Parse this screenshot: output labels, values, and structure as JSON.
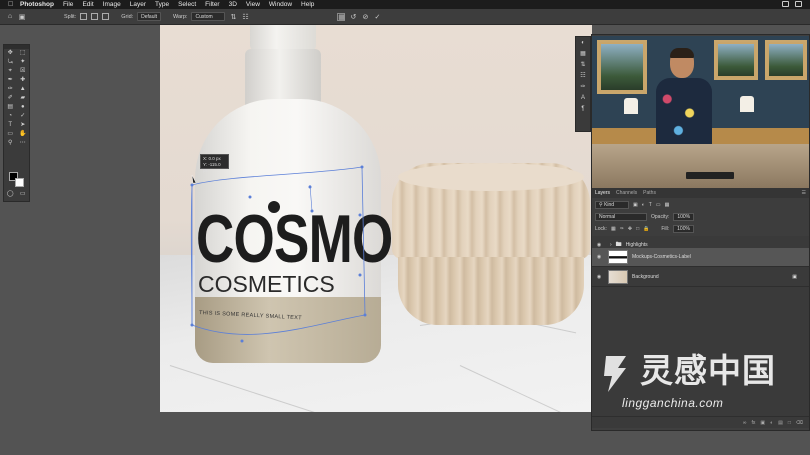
{
  "menubar": {
    "app": "Photoshop",
    "items": [
      "File",
      "Edit",
      "Image",
      "Layer",
      "Type",
      "Select",
      "Filter",
      "3D",
      "View",
      "Window",
      "Help"
    ]
  },
  "options": {
    "split_label": "Split:",
    "grid_label": "Grid:",
    "grid_value": "Default",
    "warp_label": "Warp:",
    "warp_value": "Custom"
  },
  "canvas": {
    "logo": "COSMO",
    "logo_sub": "COSMETICS",
    "logo_small": "THIS IS SOME REALLY SMALL TEXT",
    "tooltip_x": "X:    0.0 px",
    "tooltip_y": "Y:  -115.0 px"
  },
  "panel": {
    "tabs": [
      "Layers",
      "Channels",
      "Paths"
    ],
    "kind_label": "Kind",
    "blend_mode": "Normal",
    "opacity_label": "Opacity:",
    "opacity_value": "100%",
    "lock_label": "Lock:",
    "fill_label": "Fill:",
    "fill_value": "100%",
    "layers": [
      {
        "name": "Highlights",
        "type": "group",
        "selected": false
      },
      {
        "name": "Mockups-Cosmetics-Label",
        "type": "smart",
        "selected": true
      },
      {
        "name": "Background",
        "type": "image",
        "selected": false
      }
    ]
  },
  "watermark": {
    "text": "灵感中国",
    "url": "lingganchina.com"
  }
}
